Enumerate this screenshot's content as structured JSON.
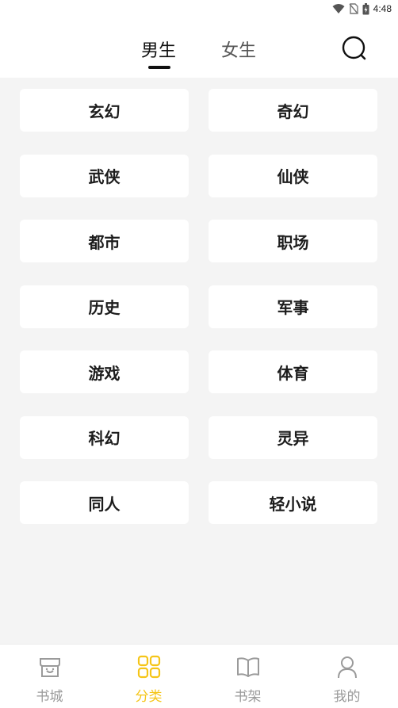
{
  "status": {
    "time": "4:48"
  },
  "tabs": [
    {
      "label": "男生",
      "active": true
    },
    {
      "label": "女生",
      "active": false
    }
  ],
  "categories": [
    "玄幻",
    "奇幻",
    "武侠",
    "仙侠",
    "都市",
    "职场",
    "历史",
    "军事",
    "游戏",
    "体育",
    "科幻",
    "灵异",
    "同人",
    "轻小说"
  ],
  "bottom_nav": [
    {
      "label": "书城",
      "icon": "store-icon",
      "active": false
    },
    {
      "label": "分类",
      "icon": "grid-icon",
      "active": true
    },
    {
      "label": "书架",
      "icon": "open-book-icon",
      "active": false
    },
    {
      "label": "我的",
      "icon": "person-icon",
      "active": false
    }
  ],
  "colors": {
    "accent": "#f5c518",
    "inactive": "#9a9a9a",
    "background": "#f4f4f4"
  }
}
